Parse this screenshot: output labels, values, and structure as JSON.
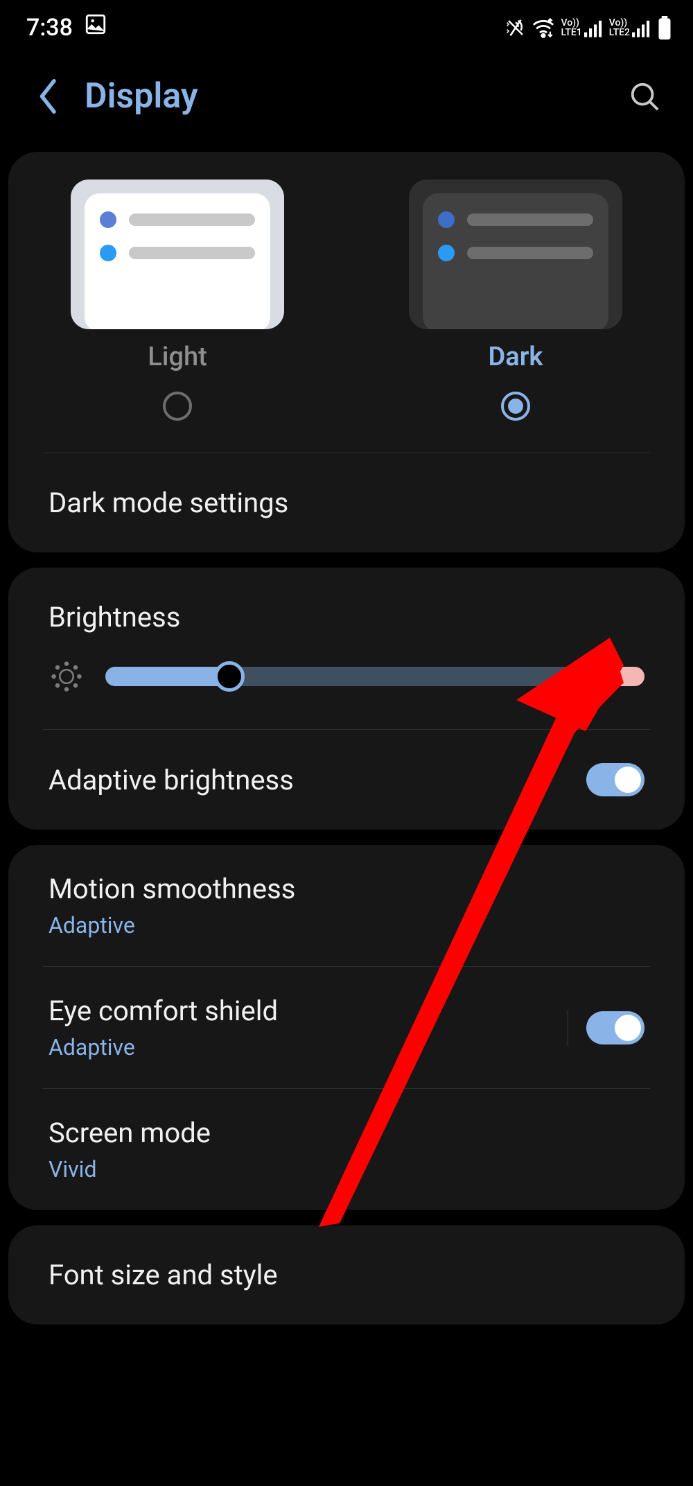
{
  "status": {
    "time": "7:38",
    "sim1": "LTE1",
    "sim2": "LTE2"
  },
  "header": {
    "title": "Display"
  },
  "theme": {
    "light_label": "Light",
    "dark_label": "Dark",
    "selected": "dark",
    "settings_label": "Dark mode settings"
  },
  "brightness": {
    "title": "Brightness",
    "value_percent": 23,
    "adaptive_label": "Adaptive brightness",
    "adaptive_on": true
  },
  "items": {
    "motion": {
      "title": "Motion smoothness",
      "sub": "Adaptive"
    },
    "eye": {
      "title": "Eye comfort shield",
      "sub": "Adaptive",
      "on": true
    },
    "screen_mode": {
      "title": "Screen mode",
      "sub": "Vivid"
    },
    "font": {
      "title": "Font size and style"
    }
  },
  "colors": {
    "accent": "#8ab4e8",
    "card": "#171717",
    "annotation_arrow": "#ff0000"
  }
}
